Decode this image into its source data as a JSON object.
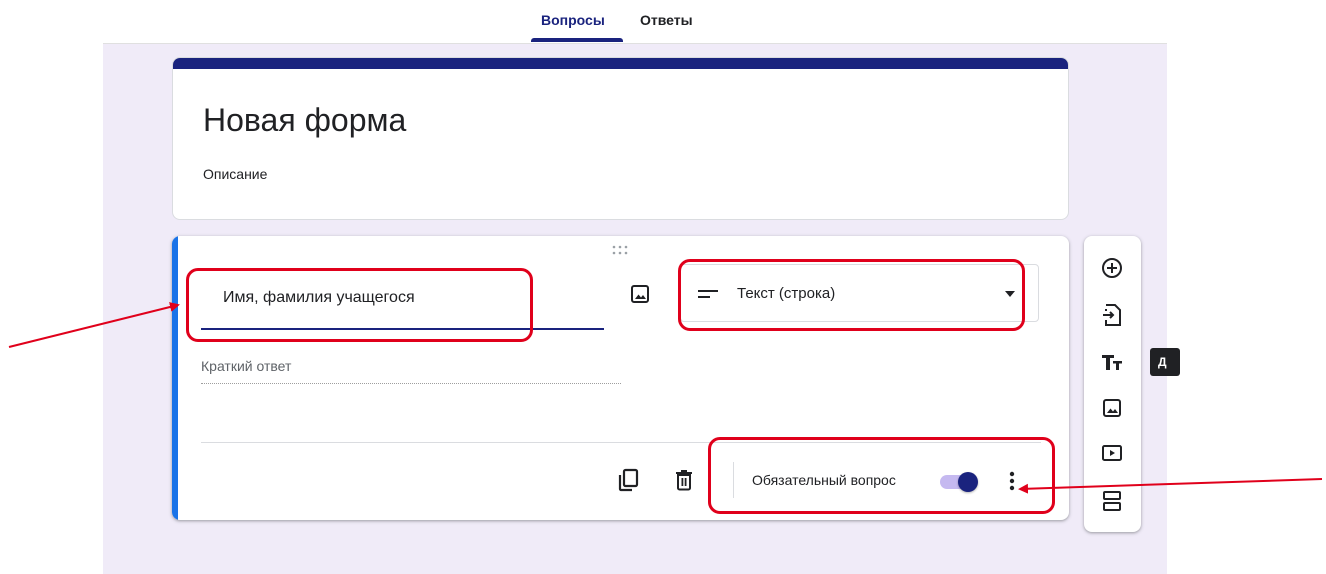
{
  "tabs": [
    {
      "label": "Вопросы",
      "active": true
    },
    {
      "label": "Ответы",
      "active": false
    }
  ],
  "form": {
    "title": "Новая форма",
    "description": "Описание",
    "accent_color": "#1a237e",
    "background_color": "#f0ebf8"
  },
  "question": {
    "title": "Имя, фамилия учащегося",
    "type_label": "Текст (строка)",
    "answer_placeholder": "Краткий ответ",
    "required_label": "Обязательный вопрос",
    "required_on": true
  },
  "side_toolbar": {
    "items": [
      "add-question-icon",
      "import-questions-icon",
      "add-title-icon",
      "add-image-icon",
      "add-video-icon",
      "add-section-icon"
    ],
    "tooltip_text": "Д"
  },
  "annotations": {
    "color": "#e0001b"
  }
}
